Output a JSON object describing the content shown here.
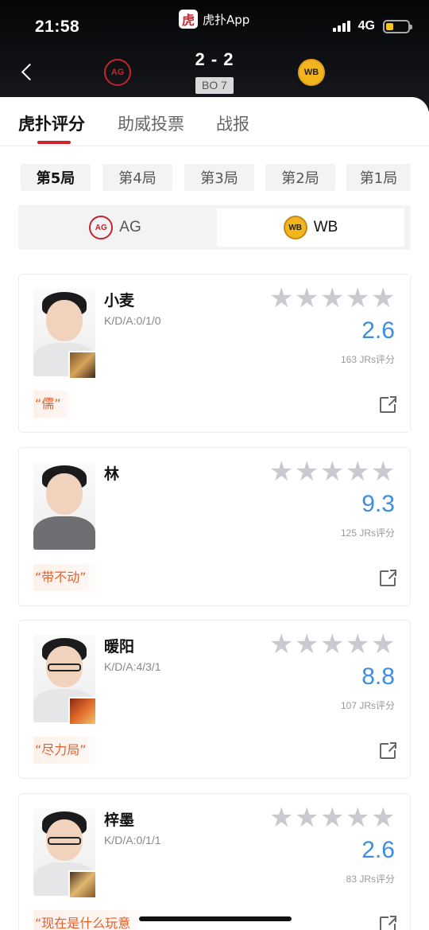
{
  "status": {
    "time": "21:58",
    "app_name": "虎扑App",
    "app_logo_char": "虎",
    "network": "4G",
    "battery_fraction": 0.35
  },
  "match": {
    "score": "2 - 2",
    "format": "BO 7",
    "team_left_logo": "AG",
    "team_right_logo": "WB"
  },
  "tabs": [
    {
      "label": "虎扑评分"
    },
    {
      "label": "助威投票"
    },
    {
      "label": "战报"
    }
  ],
  "games": [
    {
      "label": "第5局"
    },
    {
      "label": "第4局"
    },
    {
      "label": "第3局"
    },
    {
      "label": "第2局"
    },
    {
      "label": "第1局"
    }
  ],
  "teams": [
    {
      "label": "AG",
      "logo": "AG"
    },
    {
      "label": "WB",
      "logo": "WB"
    }
  ],
  "players": [
    {
      "name": "小麦",
      "kda": "K/D/A:0/1/0",
      "score": "2.6",
      "votes": "163 JRs评分",
      "tag": "“儒”",
      "stars_filled": 0,
      "hero_color": "#b07a3c"
    },
    {
      "name": "林",
      "kda": "",
      "score": "9.3",
      "votes": "125 JRs评分",
      "tag": "“带不动”",
      "stars_filled": 0,
      "hero_color": ""
    },
    {
      "name": "暖阳",
      "kda": "K/D/A:4/3/1",
      "score": "8.8",
      "votes": "107 JRs评分",
      "tag": "“尽力局”",
      "stars_filled": 0,
      "hero_color": "#c24a22"
    },
    {
      "name": "梓墨",
      "kda": "K/D/A:0/1/1",
      "score": "2.6",
      "votes": "83 JRs评分",
      "tag": "“现在是什么玩意",
      "stars_filled": 0,
      "hero_color": "#d8a85a"
    }
  ],
  "icons": {
    "back": "chevron-left-icon",
    "share": "share-icon",
    "star": "star-icon"
  }
}
